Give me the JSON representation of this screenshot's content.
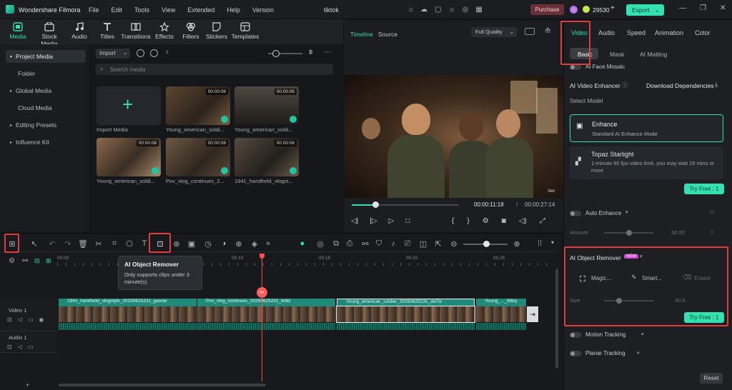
{
  "app": {
    "name": "Wondershare Filmora",
    "project_title": "tiktok",
    "menus": [
      "File",
      "Edit",
      "Tools",
      "View",
      "Extended",
      "Help",
      "Version"
    ],
    "purchase": "Purchase",
    "credits": "29530",
    "export": "Export"
  },
  "toolbar": [
    {
      "label": "Media",
      "icon": "media-icon"
    },
    {
      "label": "Stock Media",
      "icon": "stock-media-icon"
    },
    {
      "label": "Audio",
      "icon": "audio-icon"
    },
    {
      "label": "Titles",
      "icon": "titles-icon"
    },
    {
      "label": "Transitions",
      "icon": "transitions-icon"
    },
    {
      "label": "Effects",
      "icon": "effects-icon"
    },
    {
      "label": "Filters",
      "icon": "filters-icon"
    },
    {
      "label": "Stickers",
      "icon": "stickers-icon"
    },
    {
      "label": "Templates",
      "icon": "templates-icon"
    }
  ],
  "sidebar": [
    "Project Media",
    "Folder",
    "Global Media",
    "Cloud Media",
    "Editing Presets",
    "Influence Kit"
  ],
  "media": {
    "import_btn": "Import",
    "search_placeholder": "Search media",
    "import_tile": "Import Media",
    "clips": [
      {
        "name": "Young_american_soldi...",
        "dur": "00:00:08"
      },
      {
        "name": "Young_american_soldi...",
        "dur": "00:00:08"
      },
      {
        "name": "Young_american_soldi...",
        "dur": "00:00:08"
      },
      {
        "name": "Pov_vlog_continues_2...",
        "dur": "00:00:08"
      },
      {
        "name": "1941_handheld_vlogst...",
        "dur": "00:00:08"
      }
    ]
  },
  "player": {
    "tab_timeline": "Timeline",
    "tab_source": "Source",
    "quality": "Full Quality",
    "current": "00:00:11:18",
    "total": "00:00:27:14",
    "progress": 0.22,
    "watermark": "Veo"
  },
  "inspector": {
    "tabs": [
      "Video",
      "Audio",
      "Speed",
      "Animation",
      "Color"
    ],
    "subtabs": [
      "Basic",
      "Mask",
      "AI Matting"
    ],
    "face_mosaic": "AI Face Mosaic",
    "enhancer": "AI Video Enhancer",
    "download_dep": "Download Dependencies",
    "select_model": "Select Model",
    "enhance_title": "Enhance",
    "enhance_sub": "Standard AI Enhance Mode",
    "topaz_title": "Topaz Starlight",
    "topaz_sub": "1-minute 60 fps video limit, you may wait 15 mins or more",
    "try_free": "Try Free : 1",
    "auto_enhance": "Auto Enhance",
    "amount": "Amount",
    "amount_val": "50.00",
    "amount_level": 0.5,
    "object_remover": "AI Object Remover",
    "new_badge": "NEW",
    "magic": "Magic...",
    "smart": "Smart...",
    "eraser": "Eraser",
    "size": "Size",
    "size_val": "30.0",
    "size_level": 0.3,
    "try_free2": "Try Free : 1",
    "motion_tracking": "Motion Tracking",
    "planar_tracking": "Planar Tracking",
    "reset": "Reset"
  },
  "timeline": {
    "ruler": [
      "00:00",
      "00:10",
      "00:15",
      "00:20",
      "00:25"
    ],
    "tooltip_title": "AI Object Remover",
    "tooltip_text": "Only supports clips under 3 minute(s)",
    "track_video": "Video 1",
    "track_audio": "Audio 1",
    "clips": [
      "1941_handheld_vlogstyle_20250625231_gaxow",
      "Pov_vlog_continues_20250625231_fe9d",
      "Young_american_soldier_20250625231_dvi7e",
      "Young_..._96kq"
    ]
  },
  "colors": {
    "accent": "#32e0b0",
    "highlight": "#e23b3b",
    "playhead": "#ff4d4d"
  }
}
